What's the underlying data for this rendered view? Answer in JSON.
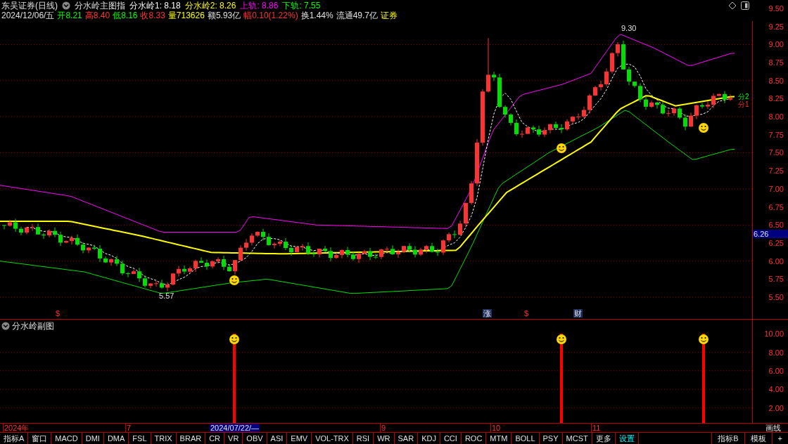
{
  "header": {
    "title": "东吴证券(日线)",
    "indicator": "分水岭主图指",
    "values": [
      {
        "text": "分水岭1: 8.18",
        "color": "#ffffff"
      },
      {
        "text": "分水岭2: 8.26",
        "color": "#ffff00"
      },
      {
        "text": "上轨: 8.86",
        "color": "#ff00ff"
      },
      {
        "text": "下轨: 7.55",
        "color": "#00ff00"
      }
    ]
  },
  "quote": {
    "date": "2024/12/06/五",
    "stats": [
      {
        "text": "开8.21",
        "color": "#00ff00"
      },
      {
        "text": "高8.40",
        "color": "#ff3232"
      },
      {
        "text": "低8.16",
        "color": "#00ff00"
      },
      {
        "text": "收8.33",
        "color": "#ff3232"
      },
      {
        "text": "量713626",
        "color": "#ffff00"
      },
      {
        "text": "额5.93亿",
        "color": "#e0e0e0"
      },
      {
        "text": "幅0.10(1.22%)",
        "color": "#ff3232"
      },
      {
        "text": "换1.44%",
        "color": "#e0e0e0"
      },
      {
        "text": "流通49.7亿",
        "color": "#e0e0e0"
      },
      {
        "text": "证券",
        "color": "#ffff00"
      }
    ]
  },
  "main_chart": {
    "low_label": "5.57",
    "high_label": "9.30",
    "markers": [
      {
        "text": "$",
        "kind": "plain"
      },
      {
        "text": "涨",
        "kind": "boxed"
      },
      {
        "text": "$",
        "kind": "plain"
      },
      {
        "text": "财",
        "kind": "boxed"
      }
    ],
    "line_labels": [
      {
        "text": "分2",
        "kind": "line2"
      },
      {
        "text": "分1",
        "kind": "line1"
      }
    ]
  },
  "price_axis": {
    "ticks": [
      "9.50",
      "9.25",
      "9.00",
      "8.75",
      "8.50",
      "8.25",
      "8.00",
      "7.75",
      "7.50",
      "7.25",
      "7.00",
      "6.75",
      "6.50",
      "6.25",
      "6.00",
      "5.75",
      "5.50"
    ],
    "current": "6.26"
  },
  "sub_chart": {
    "title": "分水岭副图",
    "ticks": [
      "10.00",
      "8.00",
      "6.00",
      "4.00",
      "2.00"
    ]
  },
  "date_axis": {
    "labels": [
      {
        "text": "2024年",
        "selected": false
      },
      {
        "text": "7",
        "selected": false
      },
      {
        "text": "2024/07/22/—",
        "selected": true
      },
      {
        "text": "9",
        "selected": false
      },
      {
        "text": "10",
        "selected": false
      },
      {
        "text": "11",
        "selected": false
      }
    ],
    "draw_button": "画线"
  },
  "tabs": [
    {
      "text": "指标A",
      "highlighted": false
    },
    {
      "text": "窗口",
      "highlighted": false
    },
    {
      "text": "MACD",
      "highlighted": false
    },
    {
      "text": "DMI",
      "highlighted": false
    },
    {
      "text": "DMA",
      "highlighted": false
    },
    {
      "text": "FSL",
      "highlighted": false
    },
    {
      "text": "TRIX",
      "highlighted": false
    },
    {
      "text": "BRAR",
      "highlighted": false
    },
    {
      "text": "CR",
      "highlighted": false
    },
    {
      "text": "VR",
      "highlighted": false
    },
    {
      "text": "OBV",
      "highlighted": false
    },
    {
      "text": "ASI",
      "highlighted": false
    },
    {
      "text": "EMV",
      "highlighted": false
    },
    {
      "text": "VOL-TRX",
      "highlighted": false
    },
    {
      "text": "RSI",
      "highlighted": false
    },
    {
      "text": "WR",
      "highlighted": false
    },
    {
      "text": "SAR",
      "highlighted": false
    },
    {
      "text": "KDJ",
      "highlighted": false
    },
    {
      "text": "CCI",
      "highlighted": false
    },
    {
      "text": "ROC",
      "highlighted": false
    },
    {
      "text": "MTM",
      "highlighted": false
    },
    {
      "text": "BOLL",
      "highlighted": false
    },
    {
      "text": "PSY",
      "highlighted": false
    },
    {
      "text": "MCST",
      "highlighted": false
    },
    {
      "text": "更多",
      "highlighted": false
    },
    {
      "text": "设置",
      "highlighted": true
    }
  ],
  "right_tabs": [
    "指标B",
    "模板",
    "+"
  ]
}
